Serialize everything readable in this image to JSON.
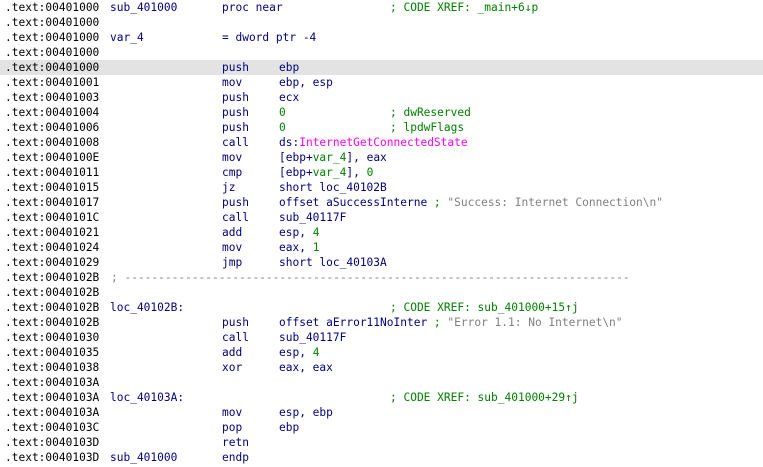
{
  "lines": [
    {
      "addr": ".text:00401000",
      "label": "sub_401000",
      "mnem": "proc near",
      "comment": "; CODE XREF: _main+6↓p"
    },
    {
      "addr": ".text:00401000"
    },
    {
      "addr": ".text:00401000",
      "label": "var_4",
      "mnem": "= dword ptr -4"
    },
    {
      "addr": ".text:00401000"
    },
    {
      "addr": ".text:00401000",
      "mnem": "push",
      "op1": "ebp",
      "selected": true
    },
    {
      "addr": ".text:00401001",
      "mnem": "mov",
      "op1": "ebp, esp"
    },
    {
      "addr": ".text:00401003",
      "mnem": "push",
      "op1": "ecx"
    },
    {
      "addr": ".text:00401004",
      "mnem": "push",
      "num": "0",
      "comment": "; dwReserved"
    },
    {
      "addr": ".text:00401006",
      "mnem": "push",
      "num": "0",
      "comment": "; lpdwFlags"
    },
    {
      "addr": ".text:00401008",
      "mnem": "call",
      "op1": "ds:",
      "import": "InternetGetConnectedState"
    },
    {
      "addr": ".text:0040100E",
      "mnem": "mov",
      "op1": "[ebp+",
      "var": "var_4",
      "op2": "], eax"
    },
    {
      "addr": ".text:00401011",
      "mnem": "cmp",
      "op1": "[ebp+",
      "var": "var_4",
      "op2": "], ",
      "num": "0"
    },
    {
      "addr": ".text:00401015",
      "mnem": "jz",
      "op1": "short loc_40102B"
    },
    {
      "addr": ".text:00401017",
      "mnem": "push",
      "op1": "offset aSuccessInterne",
      "icmt": " ; ",
      "str": "\"Success: Internet Connection\\n\""
    },
    {
      "addr": ".text:0040101C",
      "mnem": "call",
      "op1": "sub_40117F"
    },
    {
      "addr": ".text:00401021",
      "mnem": "add",
      "op1": "esp, ",
      "num": "4"
    },
    {
      "addr": ".text:00401024",
      "mnem": "mov",
      "op1": "eax, ",
      "num": "1"
    },
    {
      "addr": ".text:00401029",
      "mnem": "jmp",
      "op1": "short loc_40103A"
    },
    {
      "addr": ".text:0040102B",
      "separator": "; ---------------------------------------------------------------------------"
    },
    {
      "addr": ".text:0040102B"
    },
    {
      "addr": ".text:0040102B",
      "label": "loc_40102B:",
      "comment": "; CODE XREF: sub_401000+15↑j"
    },
    {
      "addr": ".text:0040102B",
      "mnem": "push",
      "op1": "offset aError11NoInter",
      "icmt": " ; ",
      "str": "\"Error 1.1: No Internet\\n\""
    },
    {
      "addr": ".text:00401030",
      "mnem": "call",
      "op1": "sub_40117F"
    },
    {
      "addr": ".text:00401035",
      "mnem": "add",
      "op1": "esp, ",
      "num": "4"
    },
    {
      "addr": ".text:00401038",
      "mnem": "xor",
      "op1": "eax, eax"
    },
    {
      "addr": ".text:0040103A"
    },
    {
      "addr": ".text:0040103A",
      "label": "loc_40103A:",
      "comment": "; CODE XREF: sub_401000+29↑j"
    },
    {
      "addr": ".text:0040103A",
      "mnem": "mov",
      "op1": "esp, ebp"
    },
    {
      "addr": ".text:0040103C",
      "mnem": "pop",
      "op1": "ebp"
    },
    {
      "addr": ".text:0040103D",
      "mnem": "retn"
    },
    {
      "addr": ".text:0040103D",
      "label": "sub_401000",
      "mnem": "endp"
    }
  ],
  "colors": {
    "address": "#000000",
    "code": "#000080",
    "comment": "#008000",
    "string": "#808080",
    "import": "#ff00ff",
    "selection": "#e3e3e3"
  }
}
